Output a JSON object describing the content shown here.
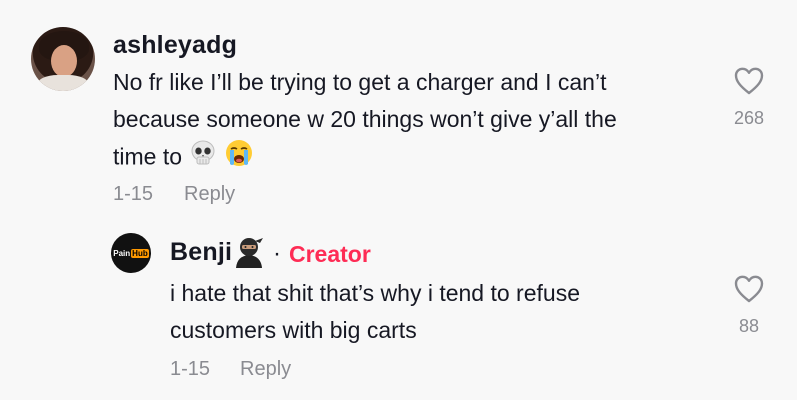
{
  "comment": {
    "username": "ashleyadg",
    "text": "No fr like I’ll be trying to get a charger and I can’t\nbecause someone w 20 things won’t give y’all the\ntime to",
    "date": "1-15",
    "reply_label": "Reply",
    "likes": "268",
    "emojis": [
      "skull-emoji",
      "crying-emoji"
    ]
  },
  "reply": {
    "username": "Benji",
    "avatar_logo": {
      "part1": "Pain",
      "part2": "Hub"
    },
    "separator": "·",
    "creator_label": "Creator",
    "text": "i hate that shit that’s why i tend to refuse\ncustomers with big carts",
    "date": "1-15",
    "reply_label": "Reply",
    "likes": "88"
  },
  "colors": {
    "background": "#f8f8f8",
    "text": "#161823",
    "meta": "#8a8b91",
    "creator": "#fe2c55"
  }
}
